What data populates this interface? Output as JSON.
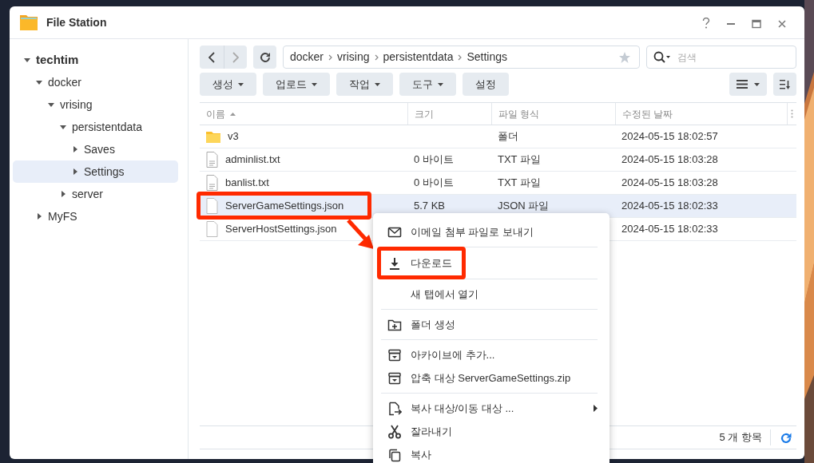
{
  "window": {
    "title": "File Station"
  },
  "tree": [
    {
      "label": "techtim",
      "expanded": true,
      "selected": false,
      "children": [
        {
          "label": "docker",
          "expanded": true,
          "selected": false,
          "children": [
            {
              "label": "vrising",
              "expanded": true,
              "selected": false,
              "children": [
                {
                  "label": "persistentdata",
                  "expanded": true,
                  "selected": false,
                  "children": [
                    {
                      "label": "Saves",
                      "expanded": false,
                      "selected": false
                    },
                    {
                      "label": "Settings",
                      "expanded": false,
                      "selected": true
                    }
                  ]
                },
                {
                  "label": "server",
                  "expanded": false,
                  "selected": false
                }
              ]
            }
          ]
        },
        {
          "label": "MyFS",
          "expanded": false,
          "selected": false
        }
      ]
    }
  ],
  "path": [
    "docker",
    "vrising",
    "persistentdata",
    "Settings"
  ],
  "search": {
    "placeholder": "검색"
  },
  "toolbar": [
    {
      "label": "생성",
      "dropdown": true
    },
    {
      "label": "업로드",
      "dropdown": true
    },
    {
      "label": "작업",
      "dropdown": true
    },
    {
      "label": "도구",
      "dropdown": true
    },
    {
      "label": "설정",
      "dropdown": false
    }
  ],
  "table": {
    "columns": [
      {
        "label": "이름",
        "sorted": true
      },
      {
        "label": "크기",
        "sorted": false
      },
      {
        "label": "파일 형식",
        "sorted": false
      },
      {
        "label": "수정된 날짜",
        "sorted": false
      }
    ],
    "rows": [
      {
        "kind": "folder",
        "name": "v3",
        "size": "",
        "type": "폴더",
        "modified": "2024-05-15 18:02:57",
        "selected": false,
        "highlighted": false
      },
      {
        "kind": "text",
        "name": "adminlist.txt",
        "size": "0 바이트",
        "type": "TXT 파일",
        "modified": "2024-05-15 18:03:28",
        "selected": false,
        "highlighted": false
      },
      {
        "kind": "text",
        "name": "banlist.txt",
        "size": "0 바이트",
        "type": "TXT 파일",
        "modified": "2024-05-15 18:03:28",
        "selected": false,
        "highlighted": false
      },
      {
        "kind": "blank",
        "name": "ServerGameSettings.json",
        "size": "5.7 KB",
        "type": "JSON 파일",
        "modified": "2024-05-15 18:02:33",
        "selected": true,
        "highlighted": true
      },
      {
        "kind": "blank",
        "name": "ServerHostSettings.json",
        "size": "",
        "type": "",
        "modified": "2024-05-15 18:02:33",
        "selected": false,
        "highlighted": false
      }
    ]
  },
  "status_bar": {
    "count": "5 개 항목"
  },
  "context_menu": {
    "groups": [
      [
        {
          "kind": "mail",
          "label": "이메일 첨부 파일로 보내기",
          "highlighted": false,
          "submenu": false
        }
      ],
      [
        {
          "kind": "download",
          "label": "다운로드",
          "highlighted": true,
          "submenu": false
        }
      ],
      [
        {
          "kind": "plain",
          "label": "새 탭에서 열기",
          "highlighted": false,
          "submenu": false
        }
      ],
      [
        {
          "kind": "new-folder",
          "label": "폴더 생성",
          "highlighted": false,
          "submenu": false
        }
      ],
      [
        {
          "kind": "archive",
          "label": "아카이브에 추가...",
          "highlighted": false,
          "submenu": false
        },
        {
          "kind": "archive",
          "label": "압축 대상 ServerGameSettings.zip",
          "highlighted": false,
          "submenu": false
        }
      ],
      [
        {
          "kind": "move",
          "label": "복사 대상/이동 대상 ...",
          "highlighted": false,
          "submenu": true
        },
        {
          "kind": "cut",
          "label": "잘라내기",
          "highlighted": false,
          "submenu": false
        },
        {
          "kind": "copy",
          "label": "복사",
          "highlighted": false,
          "submenu": false
        }
      ]
    ]
  }
}
